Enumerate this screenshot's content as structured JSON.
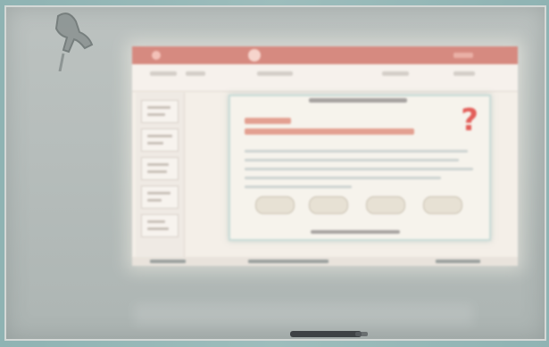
{
  "scene": {
    "description_visible_text": "",
    "projected_slide": {
      "title_lines": [
        "",
        ""
      ],
      "question_mark": "?"
    }
  },
  "colors": {
    "whiteboard": "#b8bfbd",
    "frame": "#8fb3b3",
    "projection": "#f4efe8",
    "title_bar": "#d68a80",
    "slide_title": "#e3a091",
    "question_mark": "#e35f5a"
  },
  "icons": {
    "clip": "binder-clip-icon",
    "marker": "marker-pen-icon"
  }
}
